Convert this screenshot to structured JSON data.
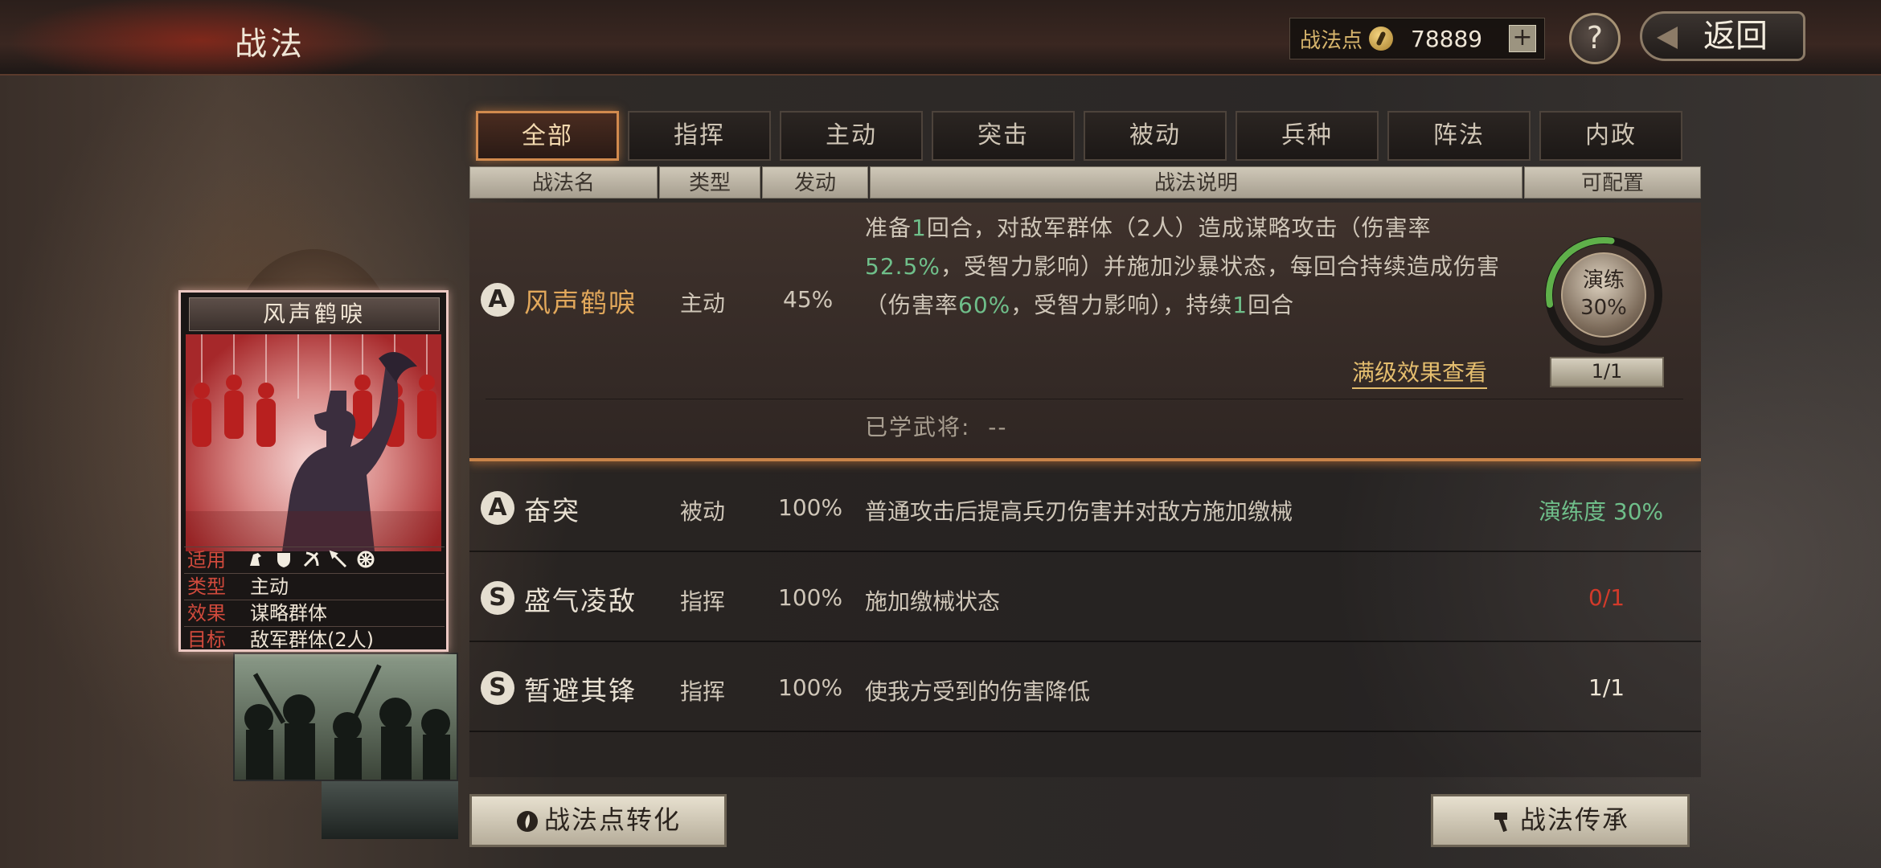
{
  "header": {
    "title": "战法",
    "points_label": "战法点",
    "points_value": "78889",
    "plus_label": "+",
    "help_label": "?",
    "back_label": "返回"
  },
  "tabs": [
    {
      "label": "全部",
      "active": true
    },
    {
      "label": "指挥"
    },
    {
      "label": "主动"
    },
    {
      "label": "突击"
    },
    {
      "label": "被动"
    },
    {
      "label": "兵种"
    },
    {
      "label": "阵法"
    },
    {
      "label": "内政"
    }
  ],
  "columns": {
    "name": "战法名",
    "type": "类型",
    "trigger": "发动",
    "desc": "战法说明",
    "config": "可配置"
  },
  "selected": {
    "grade": "A",
    "name": "风声鹤唳",
    "type": "主动",
    "trigger": "45%",
    "desc": {
      "p1": "准备",
      "g1": "1",
      "p2": "回合，对敌军群体（2人）造成谋略攻击（伤害率",
      "g2": "52.5%",
      "p3": "，受智力影响）并施加沙暴状态，每回合持续造成伤害（伤害率",
      "g3": "60%",
      "p4": "，受智力影响），持续",
      "g4": "1",
      "p5": "回合"
    },
    "full_link": "满级效果查看",
    "learned_label": "已学武将:",
    "learned_value": "--",
    "train_label": "演练",
    "train_pct": "30%",
    "train_progress": 0.3,
    "count": "1/1"
  },
  "rows": [
    {
      "grade": "A",
      "name": "奋突",
      "type": "被动",
      "trigger": "100%",
      "desc": "普通攻击后提高兵刃伤害并对敌方施加缴械",
      "status": "演练度 30%",
      "status_color": "green"
    },
    {
      "grade": "S",
      "name": "盛气凌敌",
      "type": "指挥",
      "trigger": "100%",
      "desc": "施加缴械状态",
      "status": "0/1",
      "status_color": "red"
    },
    {
      "grade": "S",
      "name": "暂避其锋",
      "type": "指挥",
      "trigger": "100%",
      "desc": "使我方受到的伤害降低",
      "status": "1/1",
      "status_color": "white"
    }
  ],
  "card": {
    "title": "风声鹤唳",
    "suit_label": "适用",
    "type_label": "类型",
    "type_value": "主动",
    "effect_label": "效果",
    "effect_value": "谋略群体",
    "target_label": "目标",
    "target_value": "敌军群体(2人)",
    "suit_icons": [
      "cavalry-icon",
      "shield-icon",
      "bow-icon",
      "spear-icon",
      "wheel-icon"
    ]
  },
  "buttons": {
    "convert": "战法点转化",
    "inherit": "战法传承"
  },
  "colors": {
    "accent": "#d18a4e",
    "gold": "#e2a85b",
    "green": "#6fbf8a",
    "red": "#d23a2a"
  }
}
